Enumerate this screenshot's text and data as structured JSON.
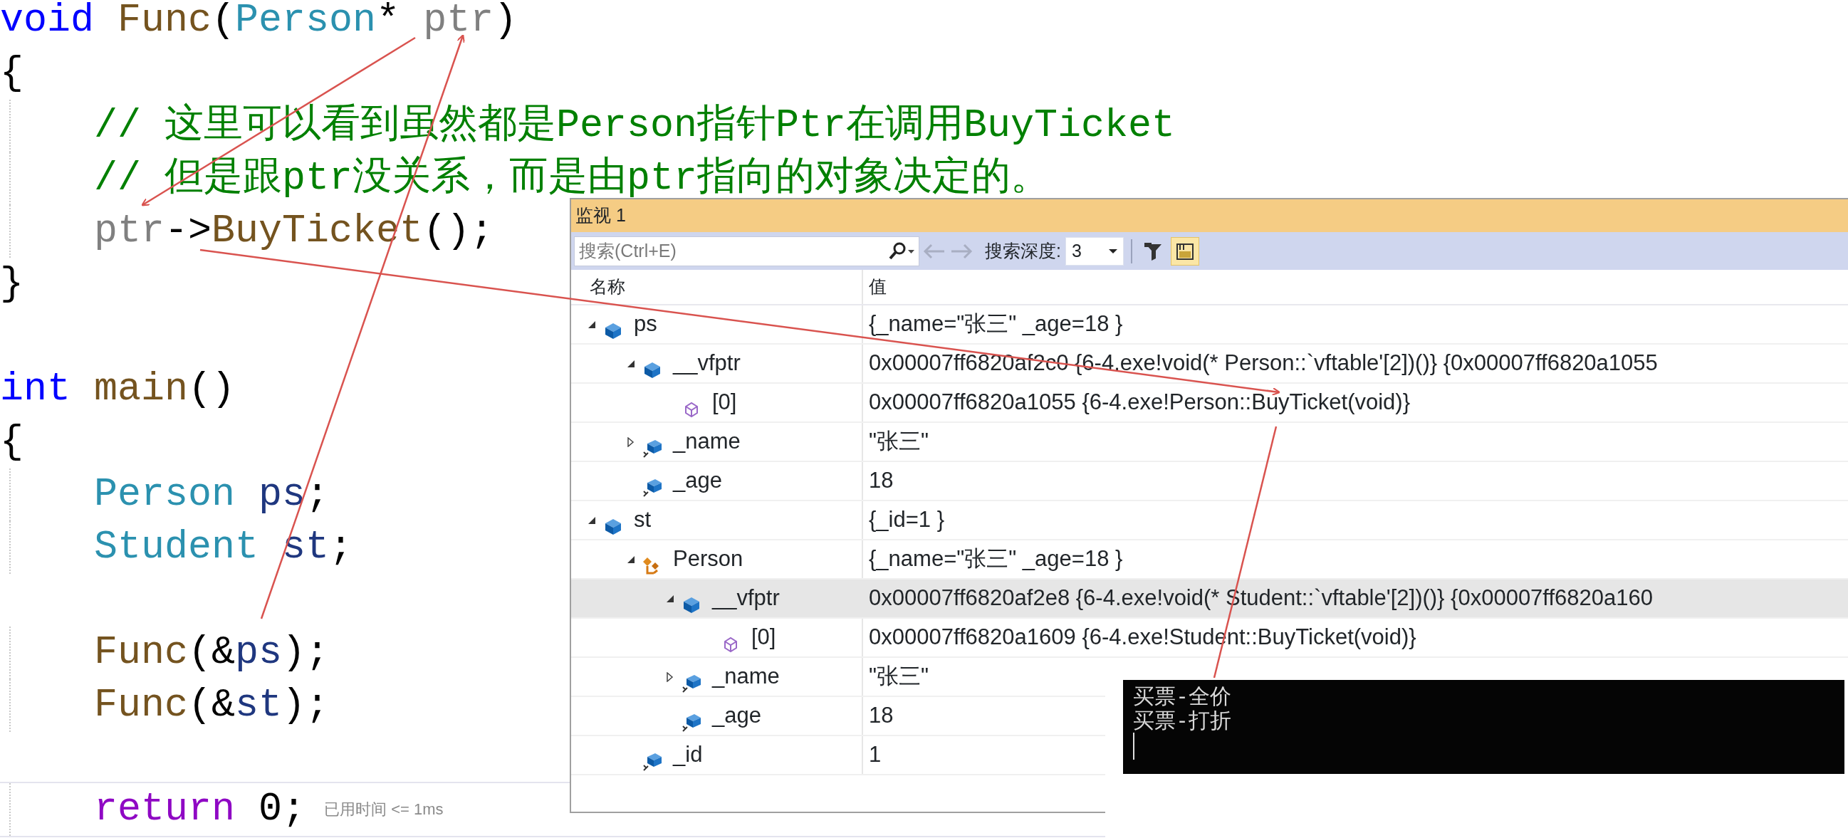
{
  "editor": {
    "lines": [
      {
        "kind": "code",
        "tokens": [
          {
            "kind": "keyword",
            "text": "void "
          },
          {
            "kind": "function",
            "text": "Func"
          },
          {
            "kind": "plain",
            "text": "("
          },
          {
            "kind": "type",
            "text": "Person"
          },
          {
            "kind": "plain",
            "text": "* "
          },
          {
            "kind": "param",
            "text": "ptr"
          },
          {
            "kind": "plain",
            "text": ")"
          }
        ]
      },
      {
        "kind": "code",
        "tokens": [
          {
            "kind": "plain",
            "text": "{"
          }
        ]
      },
      {
        "kind": "code",
        "indented": true,
        "tokens": [
          {
            "kind": "comment",
            "text": "// 这里可以看到虽然都是Person指针Ptr在调用BuyTicket"
          }
        ]
      },
      {
        "kind": "code",
        "indented": true,
        "tokens": [
          {
            "kind": "comment",
            "text": "// 但是跟ptr没关系，而是由ptr指向的对象决定的。"
          }
        ]
      },
      {
        "kind": "code",
        "indented": true,
        "tokens": [
          {
            "kind": "param",
            "text": "ptr"
          },
          {
            "kind": "plain",
            "text": "->"
          },
          {
            "kind": "function",
            "text": "BuyTicket"
          },
          {
            "kind": "plain",
            "text": "();"
          }
        ]
      },
      {
        "kind": "code",
        "tokens": [
          {
            "kind": "plain",
            "text": "}"
          }
        ]
      },
      {
        "kind": "blank"
      },
      {
        "kind": "code",
        "tokens": [
          {
            "kind": "keyword",
            "text": "int "
          },
          {
            "kind": "function",
            "text": "main"
          },
          {
            "kind": "plain",
            "text": "()"
          }
        ]
      },
      {
        "kind": "code",
        "tokens": [
          {
            "kind": "plain",
            "text": "{"
          }
        ]
      },
      {
        "kind": "code",
        "indented": true,
        "tokens": [
          {
            "kind": "type",
            "text": "Person "
          },
          {
            "kind": "variable",
            "text": "ps"
          },
          {
            "kind": "plain",
            "text": ";"
          }
        ]
      },
      {
        "kind": "code",
        "indented": true,
        "tokens": [
          {
            "kind": "type",
            "text": "Student "
          },
          {
            "kind": "variable",
            "text": "st"
          },
          {
            "kind": "plain",
            "text": ";"
          }
        ]
      },
      {
        "kind": "blank"
      },
      {
        "kind": "code",
        "indented": true,
        "tokens": [
          {
            "kind": "function",
            "text": "Func"
          },
          {
            "kind": "plain",
            "text": "(&"
          },
          {
            "kind": "variable",
            "text": "ps"
          },
          {
            "kind": "plain",
            "text": ");"
          }
        ]
      },
      {
        "kind": "code",
        "indented": true,
        "tokens": [
          {
            "kind": "function",
            "text": "Func"
          },
          {
            "kind": "plain",
            "text": "(&"
          },
          {
            "kind": "variable",
            "text": "st"
          },
          {
            "kind": "plain",
            "text": ");"
          }
        ]
      },
      {
        "kind": "blank"
      },
      {
        "kind": "code",
        "indented": true,
        "perf_tip": "已用时间 <= 1ms",
        "tokens": [
          {
            "kind": "control",
            "text": "return"
          },
          {
            "kind": "plain",
            "text": " 0;"
          }
        ]
      }
    ]
  },
  "watch_window": {
    "title": "监视 1",
    "toolbar": {
      "search": {
        "placeholder": "搜索(Ctrl+E)"
      },
      "depth_label": "搜索深度:",
      "depth_value": "3",
      "toggle_buttons": [
        {
          "kind": "filter",
          "pressed": false
        },
        {
          "kind": "tab",
          "pressed": true
        }
      ]
    },
    "columns": [
      "名称",
      "值"
    ],
    "items": [
      {
        "name": "ps",
        "value": "{_name=\"张三\" _age=18 }",
        "kind": "object",
        "expanded": true,
        "selected": false,
        "children": [
          {
            "name": "__vfptr",
            "value": "0x00007ff6820af2c0 {6-4.exe!void(* Person::`vftable'[2])()} {0x00007ff6820a1055",
            "kind": "object",
            "expanded": true,
            "selected": false,
            "children": [
              {
                "name": "[0]",
                "value": "0x00007ff6820a1055 {6-4.exe!Person::BuyTicket(void)}",
                "kind": "element",
                "selected": false
              }
            ]
          },
          {
            "name": "_name",
            "value": "\"张三\"",
            "kind": "private",
            "expanded": false,
            "selected": false
          },
          {
            "name": "_age",
            "value": "18",
            "kind": "private",
            "selected": false
          }
        ]
      },
      {
        "name": "st",
        "value": "{_id=1 }",
        "kind": "object",
        "expanded": true,
        "selected": false,
        "children": [
          {
            "name": "Person",
            "value": "{_name=\"张三\" _age=18 }",
            "kind": "base",
            "expanded": true,
            "selected": false,
            "children": [
              {
                "name": "__vfptr",
                "value": "0x00007ff6820af2e8 {6-4.exe!void(* Student::`vftable'[2])()} {0x00007ff6820a160",
                "kind": "object",
                "expanded": true,
                "selected": true,
                "children": [
                  {
                    "name": "[0]",
                    "value": "0x00007ff6820a1609 {6-4.exe!Student::BuyTicket(void)}",
                    "kind": "element",
                    "selected": false
                  }
                ]
              },
              {
                "name": "_name",
                "value": "\"张三\"",
                "kind": "private",
                "expanded": false,
                "selected": false
              },
              {
                "name": "_age",
                "value": "18",
                "kind": "private",
                "selected": false
              }
            ]
          },
          {
            "name": "_id",
            "value": "1",
            "kind": "private",
            "selected": false
          }
        ]
      }
    ]
  },
  "console": {
    "lines": [
      "买票-全价",
      "买票-打折"
    ],
    "cursor": true
  }
}
